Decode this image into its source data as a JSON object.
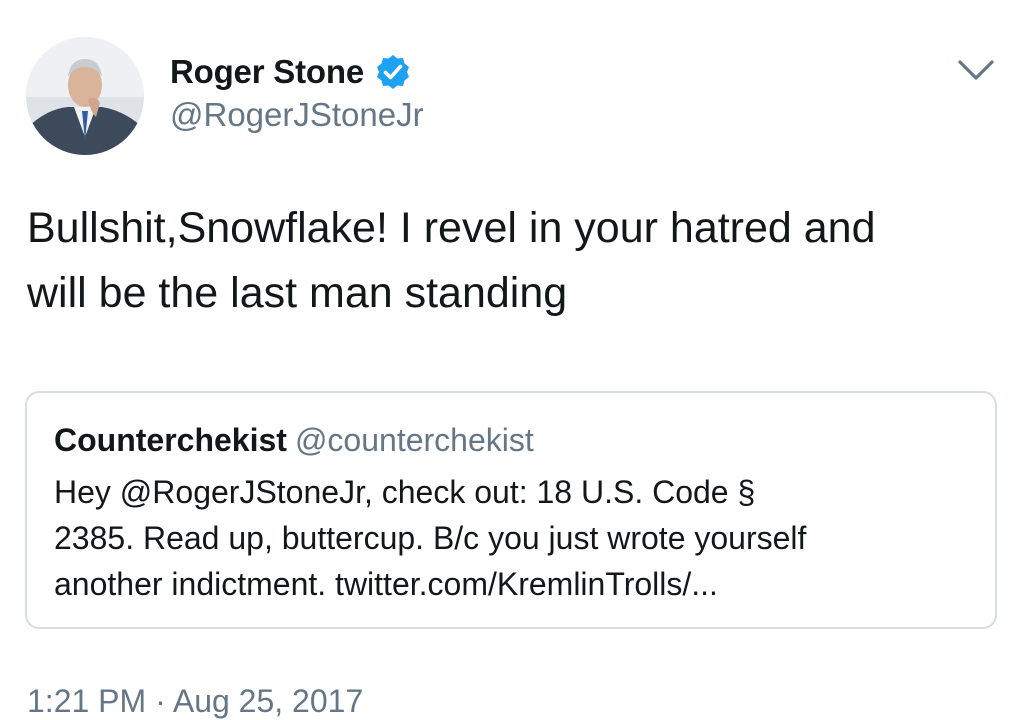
{
  "tweet": {
    "author": {
      "display_name": "Roger Stone",
      "handle": "@RogerJStoneJr",
      "verified": true,
      "verified_icon": "verified-badge-icon",
      "avatar": "profile-photo"
    },
    "menu_icon": "chevron-down-icon",
    "text_line_1": "Bullshit,Snowflake! I revel in your hatred and",
    "text_line_2": "will be the last man standing",
    "quoted_tweet": {
      "display_name": "Counterchekist",
      "handle": "@counterchekist",
      "text_line_1": "Hey @RogerJStoneJr, check out: 18 U.S. Code §",
      "text_line_2": "2385. Read up, buttercup. B/c you just wrote yourself",
      "text_line_3": "another indictment. twitter.com/KremlinTrolls/..."
    },
    "timestamp": "1:21 PM · Aug 25, 2017"
  },
  "colors": {
    "primary_text": "#14171a",
    "secondary_text": "#657786",
    "verified_blue": "#1da1f2",
    "card_border": "#d7dde2"
  }
}
